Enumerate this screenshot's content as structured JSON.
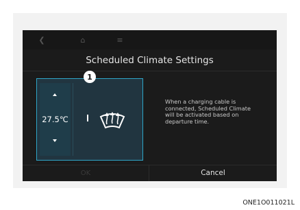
{
  "screen": {
    "title": "Scheduled Climate Settings",
    "temperature": "27.5℃",
    "callout_number": "1",
    "info_text": "When a charging cable is connected, Scheduled Climate will be activated based on departure time.",
    "ok_label": "OK",
    "cancel_label": "Cancel"
  },
  "icons": [
    "back-icon",
    "home-icon",
    "menu-icon",
    "arrow-up-icon",
    "arrow-down-icon",
    "front-defrost-icon"
  ],
  "caption": "ONE1O011021L",
  "colors": {
    "accent": "#2fa6c8",
    "panel": "#213540",
    "screen": "#1b1b1b"
  }
}
